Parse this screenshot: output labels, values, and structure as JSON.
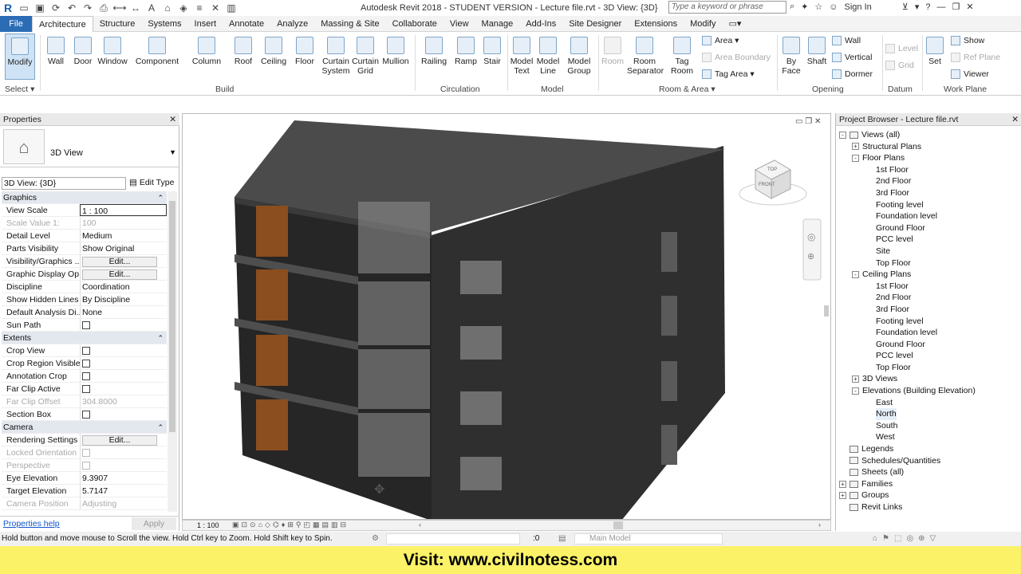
{
  "app": {
    "title": "Autodesk Revit 2018 - STUDENT VERSION -    Lecture file.rvt - 3D View: {3D}",
    "search_placeholder": "Type a keyword or phrase",
    "sign_in": "Sign In"
  },
  "tabs": [
    "File",
    "Architecture",
    "Structure",
    "Systems",
    "Insert",
    "Annotate",
    "Analyze",
    "Massing & Site",
    "Collaborate",
    "View",
    "Manage",
    "Add-Ins",
    "Site Designer",
    "Extensions",
    "Modify"
  ],
  "ribbon": {
    "modify": "Modify",
    "select": "Select ▾",
    "build": [
      "Wall",
      "Door",
      "Window",
      "Component",
      "Column",
      "Roof",
      "Ceiling",
      "Floor",
      "Curtain System",
      "Curtain Grid",
      "Mullion"
    ],
    "build_label": "Build",
    "circulation": [
      "Railing",
      "Ramp",
      "Stair"
    ],
    "circulation_label": "Circulation",
    "model": [
      "Model Text",
      "Model Line",
      "Model Group"
    ],
    "model_label": "Model",
    "room": [
      "Room",
      "Room Separator",
      "Tag Room"
    ],
    "room_small": [
      "Area ▾",
      "Area  Boundary",
      "Tag  Area ▾"
    ],
    "room_label": "Room & Area ▾",
    "opening": [
      "By Face",
      "Shaft"
    ],
    "opening_small": [
      "Wall",
      "Vertical",
      "Dormer"
    ],
    "opening_label": "Opening",
    "datum_small": [
      "Level",
      "Grid"
    ],
    "datum_label": "Datum",
    "wp": [
      "Set"
    ],
    "wp_small": [
      "Show",
      "Ref  Plane",
      "Viewer"
    ],
    "wp_label": "Work Plane"
  },
  "properties": {
    "title": "Properties",
    "type_name": "3D View",
    "instance": "3D View: {3D}",
    "edit_type": "Edit Type",
    "rows": [
      {
        "k": "Graphics",
        "group": true
      },
      {
        "k": "View Scale",
        "v": "1 : 100"
      },
      {
        "k": "Scale Value    1:",
        "v": "100",
        "dis": true
      },
      {
        "k": "Detail Level",
        "v": "Medium"
      },
      {
        "k": "Parts Visibility",
        "v": "Show Original"
      },
      {
        "k": "Visibility/Graphics ...",
        "v": "Edit...",
        "btn": true
      },
      {
        "k": "Graphic Display Op...",
        "v": "Edit...",
        "btn": true
      },
      {
        "k": "Discipline",
        "v": "Coordination"
      },
      {
        "k": "Show Hidden Lines",
        "v": "By Discipline"
      },
      {
        "k": "Default Analysis Di...",
        "v": "None"
      },
      {
        "k": "Sun Path",
        "chk": true
      },
      {
        "k": "Extents",
        "group": true
      },
      {
        "k": "Crop View",
        "chk": true
      },
      {
        "k": "Crop Region Visible",
        "chk": true
      },
      {
        "k": "Annotation Crop",
        "chk": true
      },
      {
        "k": "Far Clip Active",
        "chk": true
      },
      {
        "k": "Far Clip Offset",
        "v": "304.8000",
        "dis": true
      },
      {
        "k": "Section Box",
        "chk": true
      },
      {
        "k": "Camera",
        "group": true
      },
      {
        "k": "Rendering Settings",
        "v": "Edit...",
        "btn": true
      },
      {
        "k": "Locked Orientation",
        "chk": true,
        "dis": true
      },
      {
        "k": "Perspective",
        "chk": true,
        "dis": true
      },
      {
        "k": "Eye Elevation",
        "v": "9.3907"
      },
      {
        "k": "Target Elevation",
        "v": "5.7147"
      },
      {
        "k": "Camera Position",
        "v": "Adjusting",
        "dis": true
      }
    ],
    "help": "Properties help",
    "apply": "Apply"
  },
  "view": {
    "scale": "1 : 100",
    "cube_top": "TOP",
    "cube_front": "FRONT"
  },
  "browser": {
    "title": "Project Browser - Lecture file.rvt",
    "nodes": [
      {
        "t": "Views (all)",
        "l": 0,
        "ex": "-",
        "ic": true
      },
      {
        "t": "Structural Plans",
        "l": 1,
        "ex": "+"
      },
      {
        "t": "Floor Plans",
        "l": 1,
        "ex": "-"
      },
      {
        "t": "1st Floor",
        "l": 2
      },
      {
        "t": "2nd Floor",
        "l": 2
      },
      {
        "t": "3rd Floor",
        "l": 2
      },
      {
        "t": "Footing level",
        "l": 2
      },
      {
        "t": "Foundation level",
        "l": 2
      },
      {
        "t": "Ground Floor",
        "l": 2
      },
      {
        "t": "PCC level",
        "l": 2
      },
      {
        "t": "Site",
        "l": 2
      },
      {
        "t": "Top Floor",
        "l": 2
      },
      {
        "t": "Ceiling Plans",
        "l": 1,
        "ex": "-"
      },
      {
        "t": "1st Floor",
        "l": 2
      },
      {
        "t": "2nd Floor",
        "l": 2
      },
      {
        "t": "3rd Floor",
        "l": 2
      },
      {
        "t": "Footing level",
        "l": 2
      },
      {
        "t": "Foundation level",
        "l": 2
      },
      {
        "t": "Ground Floor",
        "l": 2
      },
      {
        "t": "PCC level",
        "l": 2
      },
      {
        "t": "Top Floor",
        "l": 2
      },
      {
        "t": "3D Views",
        "l": 1,
        "ex": "+"
      },
      {
        "t": "Elevations (Building Elevation)",
        "l": 1,
        "ex": "-"
      },
      {
        "t": "East",
        "l": 2
      },
      {
        "t": "North",
        "l": 2,
        "hl": true
      },
      {
        "t": "South",
        "l": 2
      },
      {
        "t": "West",
        "l": 2
      },
      {
        "t": "Legends",
        "l": 0,
        "ic": true
      },
      {
        "t": "Schedules/Quantities",
        "l": 0,
        "ic": true
      },
      {
        "t": "Sheets (all)",
        "l": 0,
        "ic": true
      },
      {
        "t": "Families",
        "l": 0,
        "ex": "+",
        "ic": true
      },
      {
        "t": "Groups",
        "l": 0,
        "ex": "+",
        "ic": true
      },
      {
        "t": "Revit Links",
        "l": 0,
        "ic": true
      }
    ]
  },
  "status": {
    "text": "Hold button and move mouse to Scroll the view. Hold Ctrl key to Zoom. Hold Shift key to Spin.",
    "zero": ":0",
    "model": "Main Model"
  },
  "banner": "Visit: www.civilnotess.com"
}
